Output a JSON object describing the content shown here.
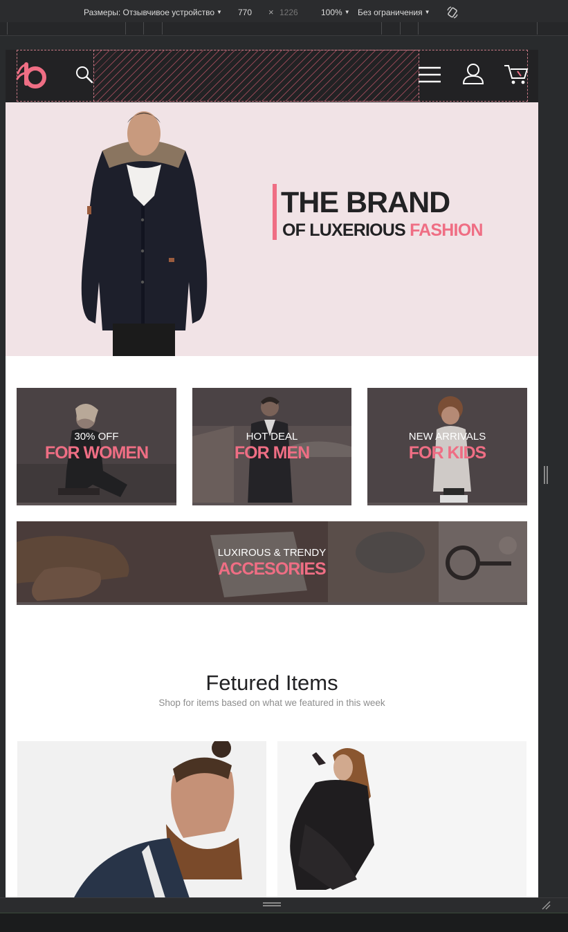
{
  "devtools": {
    "sizes_label": "Размеры: Отзывчивое устройство",
    "width": "770",
    "times": "×",
    "height": "1226",
    "zoom": "100%",
    "throttle": "Без ограничения"
  },
  "header": {
    "icons": [
      "logo",
      "search-icon",
      "menu-icon",
      "user-icon",
      "cart-icon"
    ]
  },
  "hero": {
    "title": "THE BRAND",
    "sub_prefix": "OF LUXERIOUS",
    "sub_accent": "FASHION",
    "accent_color": "#ef6e84"
  },
  "categories": [
    {
      "small": "30% OFF",
      "big": "FOR WOMEN"
    },
    {
      "small": "HOT DEAL",
      "big": "FOR MEN"
    },
    {
      "small": "NEW ARRIVALS",
      "big": "FOR KIDS"
    },
    {
      "small": "LUXIROUS & TRENDY",
      "big": "ACCESORIES"
    }
  ],
  "featured": {
    "title": "Fetured Items",
    "subtitle": "Shop for items based on what we featured in this week"
  },
  "colors": {
    "header_bg": "#222224",
    "hero_bg": "#f1e3e6",
    "accent": "#ef6e84",
    "devtools_bg": "#2b2c2e"
  }
}
